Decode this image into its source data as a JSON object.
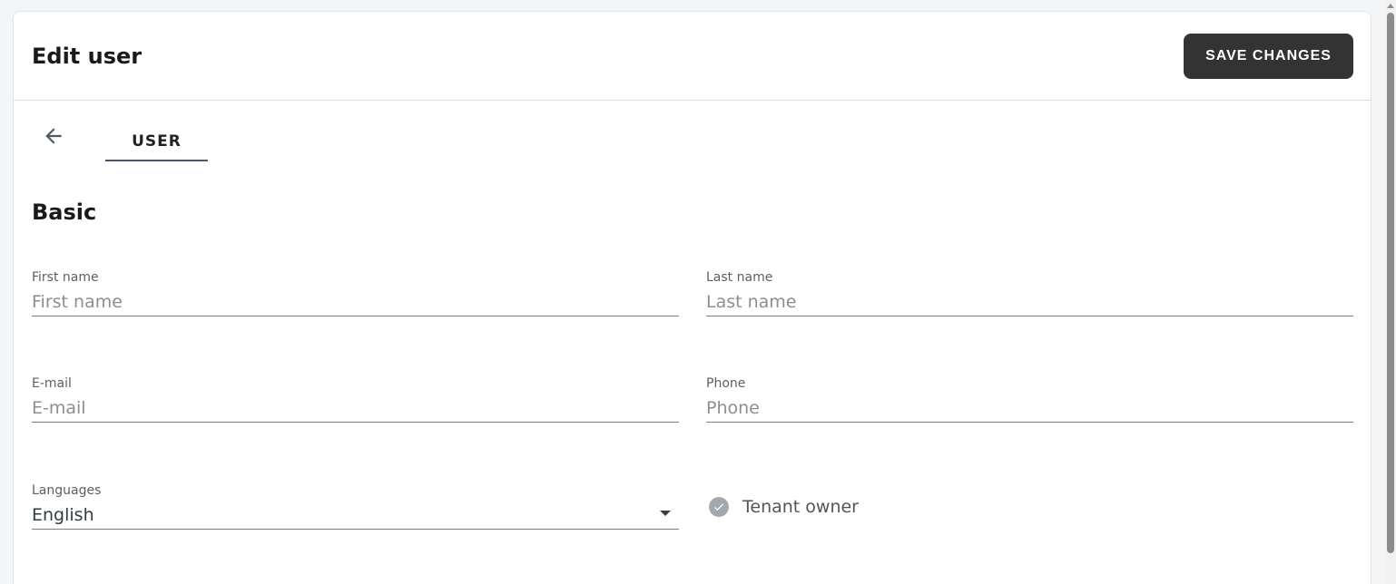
{
  "header": {
    "title": "Edit user",
    "save_label": "SAVE CHANGES"
  },
  "tabs": [
    {
      "label": "USER",
      "active": true
    }
  ],
  "icons": {
    "back": "arrow-left-icon",
    "dropdown": "chevron-down-icon",
    "checkbox": "check-circle-icon"
  },
  "section": {
    "title": "Basic"
  },
  "fields": {
    "first_name": {
      "label": "First name",
      "placeholder": "First name",
      "value": ""
    },
    "last_name": {
      "label": "Last name",
      "placeholder": "Last name",
      "value": ""
    },
    "email": {
      "label": "E-mail",
      "placeholder": "E-mail",
      "value": ""
    },
    "phone": {
      "label": "Phone",
      "placeholder": "Phone",
      "value": ""
    },
    "languages": {
      "label": "Languages",
      "value": "English"
    }
  },
  "tenant_owner": {
    "label": "Tenant owner",
    "checked": true
  },
  "colors": {
    "primary_button": "#333333",
    "tab_indicator": "#4b5563",
    "checkbox": "#a3a8ae"
  }
}
